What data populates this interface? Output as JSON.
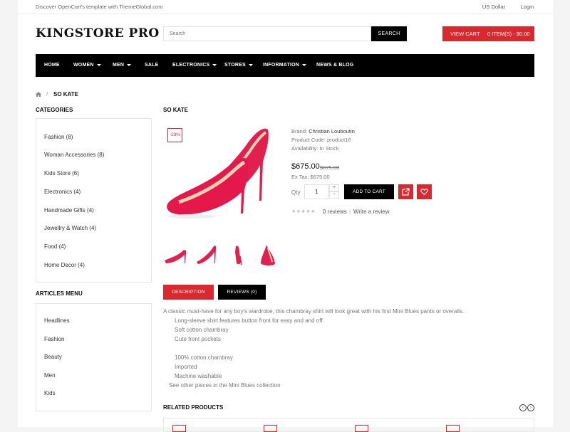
{
  "topbar": {
    "welcome": "Discover OpenCart's template with ThemeGlobal.com",
    "currency": "US Dollar",
    "login": "Login"
  },
  "header": {
    "logo": "KINGSTORE PRO",
    "search_placeholder": "Search",
    "search_button": "SEARCH",
    "view_cart": "VIEW CART",
    "cart_items": "0 ITEM(S) - $0.00"
  },
  "nav": {
    "items": [
      {
        "label": "HOME",
        "dropdown": false
      },
      {
        "label": "WOMEN",
        "dropdown": true
      },
      {
        "label": "MEN",
        "dropdown": true
      },
      {
        "label": "SALE",
        "dropdown": false
      },
      {
        "label": "ELECTRONICS",
        "dropdown": true
      },
      {
        "label": "STORES",
        "dropdown": true
      },
      {
        "label": "INFORMATION",
        "dropdown": true
      },
      {
        "label": "NEWS & BLOG",
        "dropdown": false
      }
    ]
  },
  "breadcrumb": {
    "current": "SO KATE",
    "separator": "/"
  },
  "sidebar": {
    "categories_title": "CATEGORIES",
    "categories": [
      "Fashion (8)",
      "Woman Accessories (8)",
      "Kids Store (6)",
      "Electronics (4)",
      "Handmade Gifts (4)",
      "Jewellry & Watch (4)",
      "Food (4)",
      "Home Decor (4)"
    ],
    "articles_title": "ARTICLES MENU",
    "articles": [
      "Headlines",
      "Fashion",
      "Beauty",
      "Men",
      "Kids"
    ]
  },
  "product": {
    "title": "SO KATE",
    "discount": "-23%",
    "brand_label": "Brand:",
    "brand": "Christian Louboutin",
    "code_label": "Product Code:",
    "code": "product16",
    "availability_label": "Availability:",
    "availability": "In Stock",
    "price": "$675.00",
    "old_price": "$875.00",
    "ex_tax": "Ex Tax: $675.00",
    "qty_label": "Qty",
    "qty": "1",
    "add_to_cart": "ADD TO CART",
    "stars": "★★★★★",
    "rating": 0,
    "reviews": "0 reviews",
    "review_sep": "|",
    "write_review": "Write a review",
    "plus": "+",
    "minus": "−"
  },
  "tabs": {
    "description": "DESCRIPTION",
    "reviews": "REVIEWS (0)"
  },
  "description": {
    "intro": "A classic must-have for any boy's wardrobe, this chambray shirt will look great with his first Mini Blues pants or overalls.",
    "lines": [
      "Long-sleeve shirt features button front for easy and and off",
      "Soft cotton chambray",
      "Cute front pockets",
      "100% cotton chambray",
      "Imported",
      "Machine washable"
    ],
    "more": "See other pieces in the Mini Blues collection"
  },
  "related": {
    "title": "RELATED PRODUCTS",
    "prev": "‹",
    "next": "›"
  },
  "colors": {
    "accent": "#d9282e",
    "dark": "#000000",
    "shoe": "#e0214f"
  },
  "icons": [
    "home-icon",
    "caret-down-icon",
    "share-icon",
    "heart-icon",
    "star-icon",
    "chevron-left-icon",
    "chevron-right-icon"
  ]
}
